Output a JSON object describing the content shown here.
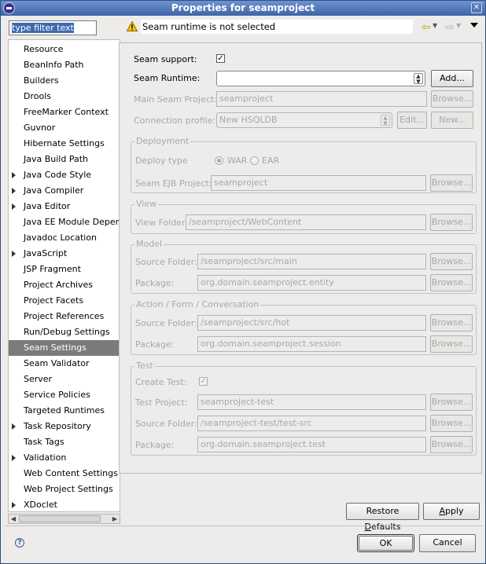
{
  "window": {
    "title": "Properties for seamproject"
  },
  "filter": {
    "placeholder": "type filter text"
  },
  "tree": {
    "items": [
      {
        "label": "Resource",
        "expandable": false
      },
      {
        "label": "BeanInfo Path",
        "expandable": false
      },
      {
        "label": "Builders",
        "expandable": false
      },
      {
        "label": "Drools",
        "expandable": false
      },
      {
        "label": "FreeMarker Context",
        "expandable": false
      },
      {
        "label": "Guvnor",
        "expandable": false
      },
      {
        "label": "Hibernate Settings",
        "expandable": false
      },
      {
        "label": "Java Build Path",
        "expandable": false
      },
      {
        "label": "Java Code Style",
        "expandable": true
      },
      {
        "label": "Java Compiler",
        "expandable": true
      },
      {
        "label": "Java Editor",
        "expandable": true
      },
      {
        "label": "Java EE Module Depend",
        "expandable": false
      },
      {
        "label": "Javadoc Location",
        "expandable": false
      },
      {
        "label": "JavaScript",
        "expandable": true
      },
      {
        "label": "JSP Fragment",
        "expandable": false
      },
      {
        "label": "Project Archives",
        "expandable": false
      },
      {
        "label": "Project Facets",
        "expandable": false
      },
      {
        "label": "Project References",
        "expandable": false
      },
      {
        "label": "Run/Debug Settings",
        "expandable": false
      },
      {
        "label": "Seam Settings",
        "expandable": false,
        "selected": true
      },
      {
        "label": "Seam Validator",
        "expandable": false
      },
      {
        "label": "Server",
        "expandable": false
      },
      {
        "label": "Service Policies",
        "expandable": false
      },
      {
        "label": "Targeted Runtimes",
        "expandable": false
      },
      {
        "label": "Task Repository",
        "expandable": true
      },
      {
        "label": "Task Tags",
        "expandable": false
      },
      {
        "label": "Validation",
        "expandable": true
      },
      {
        "label": "Web Content Settings",
        "expandable": false
      },
      {
        "label": "Web Project Settings",
        "expandable": false
      },
      {
        "label": "XDoclet",
        "expandable": true
      }
    ]
  },
  "message": {
    "text": "Seam runtime is not selected",
    "icon": "warning-icon"
  },
  "form": {
    "seam_support_label": "Seam support:",
    "seam_support_checked": true,
    "seam_runtime_label": "Seam Runtime:",
    "seam_runtime_value": "",
    "add_button": "Add...",
    "main_project_label": "Main Seam Project:",
    "main_project_value": "seamproject",
    "browse_label": "Browse...",
    "connection_profile_label": "Connection profile:",
    "connection_profile_value": "New HSQLDB",
    "edit_button": "Edit...",
    "new_button": "New...",
    "deployment": {
      "title": "Deployment",
      "deploy_type_label": "Deploy type",
      "war_label": "WAR",
      "ear_label": "EAR",
      "ejb_project_label": "Seam EJB Project:",
      "ejb_project_value": "seamproject"
    },
    "view": {
      "title": "View",
      "folder_label": "View Folder:",
      "folder_value": "/seamproject/WebContent"
    },
    "model": {
      "title": "Model",
      "source_folder_label": "Source Folder:",
      "source_folder_value": "/seamproject/src/main",
      "package_label": "Package:",
      "package_value": "org.domain.seamproject.entity"
    },
    "action": {
      "title": "Action / Form / Conversation",
      "source_folder_label": "Source Folder:",
      "source_folder_value": "/seamproject/src/hot",
      "package_label": "Package:",
      "package_value": "org.domain.seamproject.session"
    },
    "test": {
      "title": "Test",
      "create_test_label": "Create Test:",
      "create_test_checked": true,
      "test_project_label": "Test Project:",
      "test_project_value": "seamproject-test",
      "source_folder_label": "Source Folder:",
      "source_folder_value": "/seamproject-test/test-src",
      "package_label": "Package:",
      "package_value": "org.domain.seamproject.test"
    }
  },
  "buttons": {
    "restore_defaults_pre": "Restore ",
    "restore_defaults_u": "D",
    "restore_defaults_post": "efaults",
    "apply_u": "A",
    "apply_post": "pply",
    "ok": "OK",
    "cancel": "Cancel"
  },
  "colors": {
    "title_bar": "#4a6fb3",
    "selection": "#7b7b7b",
    "dialog_bg": "#edeceb"
  }
}
